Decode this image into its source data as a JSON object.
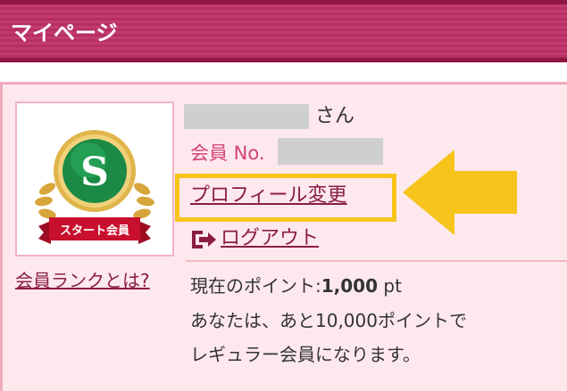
{
  "header": {
    "title": "マイページ"
  },
  "user": {
    "name_suffix": "さん",
    "member_no_label": "会員 No.",
    "badge_letter": "S",
    "badge_caption": "スタート会員"
  },
  "links": {
    "profile_change": "プロフィール変更",
    "logout": "ログアウト",
    "member_rank": "会員ランクとは?"
  },
  "points": {
    "label": "現在のポイント:",
    "value": "1,000",
    "unit": "pt",
    "notice_line1": "あなたは、あと10,000ポイントで",
    "notice_line2": "レギュラー会員になります。"
  },
  "colors": {
    "header_bg": "#c43b6f",
    "header_border": "#8e1743",
    "panel_bg": "#fde8ee",
    "link": "#8a1d45",
    "highlight": "#f6c41a",
    "badge_green": "#1a8a45",
    "badge_gold": "#d8a53a",
    "ribbon_red": "#c8102e"
  },
  "icons": {
    "arrow": "arrow-left-icon",
    "logout": "logout-icon"
  }
}
